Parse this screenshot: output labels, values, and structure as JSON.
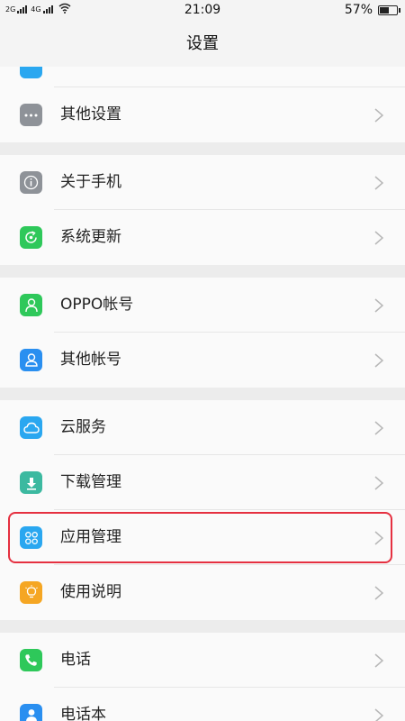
{
  "status_bar": {
    "signal1_label": "2G",
    "signal2_label": "4G",
    "time": "21:09",
    "battery_percent_text": "57%",
    "battery_level": 0.57
  },
  "header": {
    "title": "设置"
  },
  "list": {
    "items": [
      {
        "label": "",
        "icon": "partial-icon",
        "color": "#2aa7f0"
      },
      {
        "label": "其他设置",
        "icon": "more-dots-icon",
        "color": "#8e9298"
      },
      {
        "label": "关于手机",
        "icon": "info-icon",
        "color": "#8e9298"
      },
      {
        "label": "系统更新",
        "icon": "system-update-icon",
        "color": "#2ec85a"
      },
      {
        "label": "OPPO帐号",
        "icon": "oppo-account-icon",
        "color": "#2ec85a"
      },
      {
        "label": "其他帐号",
        "icon": "other-account-icon",
        "color": "#2a8ff0"
      },
      {
        "label": "云服务",
        "icon": "cloud-icon",
        "color": "#2aa7f0"
      },
      {
        "label": "下载管理",
        "icon": "download-icon",
        "color": "#3cb9a0"
      },
      {
        "label": "应用管理",
        "icon": "app-management-icon",
        "color": "#2aa7f0"
      },
      {
        "label": "使用说明",
        "icon": "lightbulb-icon",
        "color": "#f5a623"
      },
      {
        "label": "电话",
        "icon": "phone-icon",
        "color": "#2ec85a"
      },
      {
        "label": "电话本",
        "icon": "contacts-icon",
        "color": "#2a8ff0"
      }
    ]
  },
  "highlight_color": "#e53040"
}
